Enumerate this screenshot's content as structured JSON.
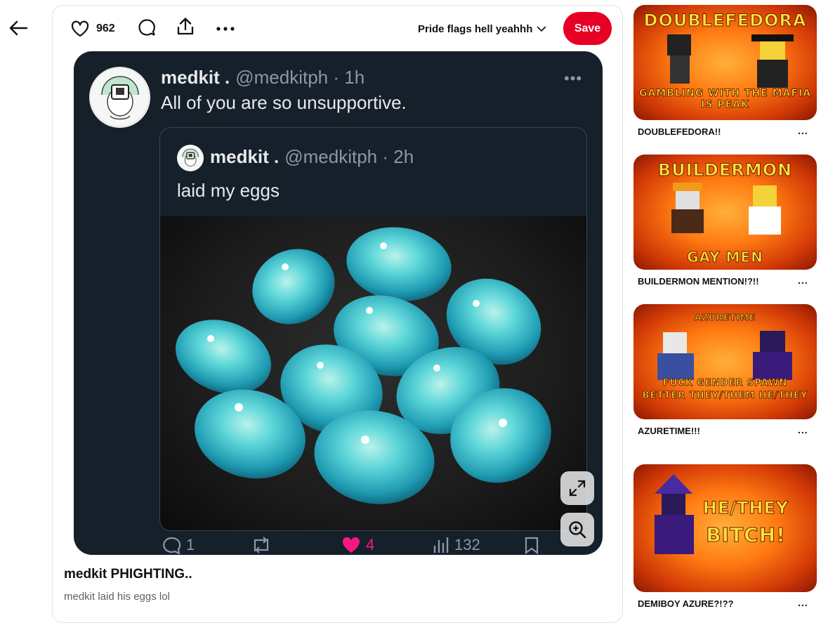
{
  "nav": {
    "back_icon": "arrow-left-icon"
  },
  "toolbar": {
    "like_count": "962",
    "board_name": "Pride flags hell yeahhh",
    "save_label": "Save"
  },
  "tweet": {
    "name": "medkit .",
    "handle": "@medkitph · 1h",
    "text": "All of you are so unsupportive.",
    "quote": {
      "name": "medkit .",
      "handle": "@medkitph · 2h",
      "text": "laid my eggs"
    },
    "actions": {
      "replies": "1",
      "likes": "4",
      "views": "132"
    }
  },
  "pin": {
    "title": "medkit PHIGHTING..",
    "description": "medkit laid his eggs lol"
  },
  "related": [
    {
      "label": "DOUBLEFEDORA!!",
      "thumb_top": "DOUBLEFEDORA",
      "thumb_bottom": "GAMBLING WITH THE MAFIA IS PEAK"
    },
    {
      "label": "BUILDERMON MENTION!?!!",
      "thumb_top": "BUILDERMON",
      "thumb_bottom": "GAY MEN"
    },
    {
      "label": "AZURETIME!!!",
      "thumb_top": "AZURETIME",
      "thumb_bottom": "FUCK GENDER SPAWN BETTER THEY/THEM HE/THEY"
    },
    {
      "label": "DEMIBOY AZURE?!??",
      "thumb_top": "HE/THEY",
      "thumb_bottom": "BITCH!"
    }
  ],
  "colors": {
    "save": "#e60023",
    "tweet_bg": "#15202b",
    "egg": "#3ec7d6"
  }
}
